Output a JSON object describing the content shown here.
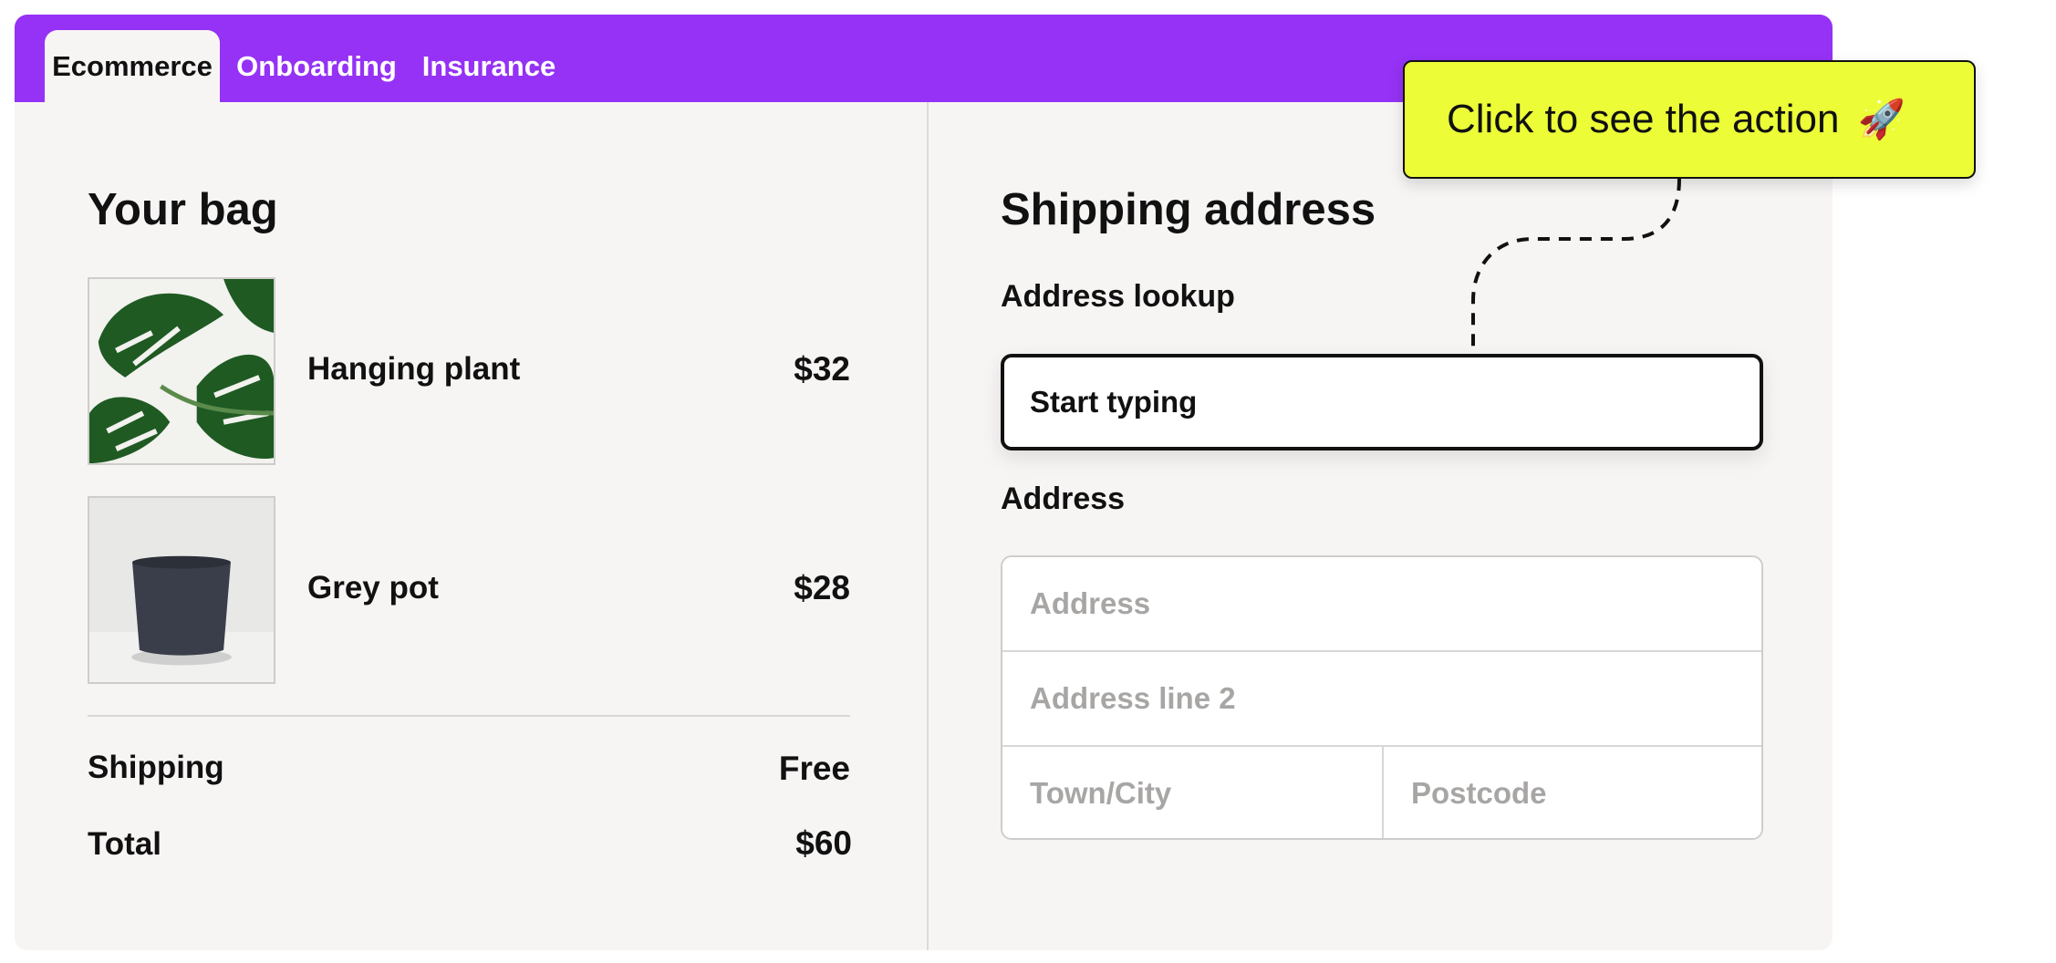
{
  "tabs": [
    {
      "label": "Ecommerce",
      "active": true
    },
    {
      "label": "Onboarding",
      "active": false
    },
    {
      "label": "Insurance",
      "active": false
    }
  ],
  "bag": {
    "title": "Your bag",
    "items": [
      {
        "name": "Hanging plant",
        "price": "$32",
        "image_icon": "monstera-plant-image"
      },
      {
        "name": "Grey pot",
        "price": "$28",
        "image_icon": "grey-pot-image"
      }
    ],
    "shipping_label": "Shipping",
    "shipping_value": "Free",
    "total_label": "Total",
    "total_value": "$60"
  },
  "shipping": {
    "title": "Shipping address",
    "lookup_label": "Address lookup",
    "lookup_value": "Start typing",
    "address_label": "Address",
    "address_placeholder": "Address",
    "address_line2_placeholder": "Address line 2",
    "town_placeholder": "Town/City",
    "postcode_placeholder": "Postcode"
  },
  "callout": {
    "text": "Click to see the action",
    "icon": "rocket-icon",
    "emoji": "🚀"
  },
  "colors": {
    "accent": "#9532f5",
    "callout_bg": "#ecfd37",
    "panel_bg": "#f7f5f4"
  }
}
